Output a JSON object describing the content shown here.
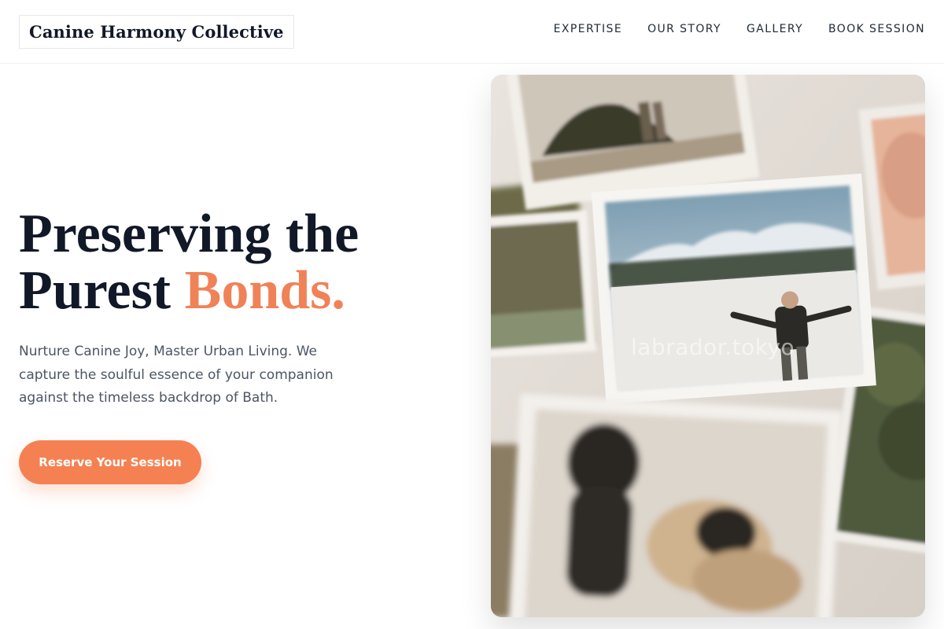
{
  "header": {
    "brand": "Canine Harmony Collective",
    "nav": [
      "EXPERTISE",
      "OUR STORY",
      "GALLERY",
      "BOOK SESSION"
    ]
  },
  "hero": {
    "headline_line1": "Preserving the",
    "headline_line2_start": "Purest ",
    "headline_accent": "Bonds.",
    "subtext": "Nurture Canine Joy, Master Urban Living. We capture the soulful essence of your companion against the timeless backdrop of Bath.",
    "cta_label": "Reserve Your Session",
    "image_watermark": "labrador.tokyo",
    "image_alt": "Scattered printed photographs including a man in snowy mountains and two pugs"
  },
  "colors": {
    "accent": "#f08258",
    "cta": "#f58152",
    "text_dark": "#111827",
    "text_muted": "#4b5563"
  }
}
